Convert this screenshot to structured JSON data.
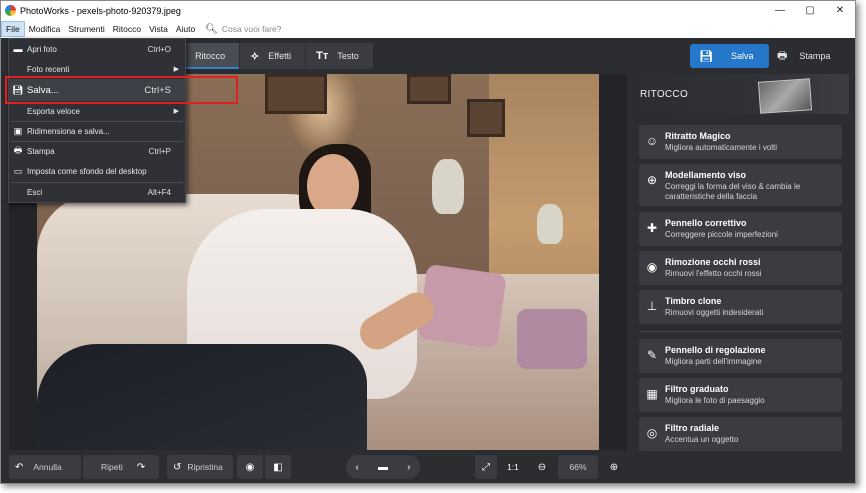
{
  "titlebar": {
    "title": "PhotoWorks - pexels-photo-920379.jpeg",
    "minimize": "—",
    "maximize": "▢",
    "close": "✕"
  },
  "menubar": {
    "items": [
      "File",
      "Modifica",
      "Strumenti",
      "Ritocco",
      "Vista",
      "Aiuto"
    ],
    "search_placeholder": "Cosa vuoi fare?"
  },
  "tabs": [
    {
      "label": "Ritocco",
      "icon": "brush-icon"
    },
    {
      "label": "Effetti",
      "icon": "magic-wand-icon"
    },
    {
      "label": "Testo",
      "icon": "text-icon"
    }
  ],
  "toolbar": {
    "save_label": "Salva",
    "print_label": "Stampa"
  },
  "file_menu": {
    "items": [
      {
        "label": "Apri foto",
        "shortcut": "Ctrl+O",
        "icon": "folder-icon"
      },
      {
        "label": "Foto recenti",
        "shortcut": "",
        "icon": "",
        "submenu": true
      },
      {
        "label": "Salva...",
        "shortcut": "Ctrl+S",
        "icon": "floppy-icon"
      },
      {
        "label": "Esporta veloce",
        "shortcut": "",
        "icon": "",
        "submenu": true
      },
      {
        "label": "Ridimensiona e salva...",
        "shortcut": "",
        "icon": "resize-icon"
      },
      {
        "label": "Stampa",
        "shortcut": "Ctrl+P",
        "icon": "printer-icon"
      },
      {
        "label": "Imposta come sfondo del desktop",
        "shortcut": "",
        "icon": "monitor-icon"
      },
      {
        "label": "Esci",
        "shortcut": "Alt+F4",
        "icon": ""
      }
    ]
  },
  "sidepanel": {
    "title": "RITOCCO",
    "tools": [
      {
        "name": "Ritratto Magico",
        "desc": "Migliora automaticamente i volti",
        "icon": "magic-portrait-icon"
      },
      {
        "name": "Modellamento viso",
        "desc": "Correggi la forma del viso & cambia le caratteristiche della faccia",
        "icon": "face-icon"
      },
      {
        "name": "Pennello correttivo",
        "desc": "Correggere piccole imperfezioni",
        "icon": "bandage-icon"
      },
      {
        "name": "Rimozione occhi rossi",
        "desc": "Rimuovi l'effetto occhi rossi",
        "icon": "eye-icon"
      },
      {
        "name": "Timbro clone",
        "desc": "Rimuovi oggetti indesiderati",
        "icon": "stamp-icon"
      },
      {
        "name": "Pennello di regolazione",
        "desc": "Migliora parti dell'immagine",
        "icon": "brush-icon"
      },
      {
        "name": "Filtro graduato",
        "desc": "Migliora le foto di paesaggio",
        "icon": "gradient-icon"
      },
      {
        "name": "Filtro radiale",
        "desc": "Accentua un oggetto",
        "icon": "radial-icon"
      }
    ]
  },
  "bottombar": {
    "undo": "Annulla",
    "redo": "Ripeti",
    "restore": "Ripristina",
    "ratio": "1:1",
    "zoom": "66%"
  }
}
